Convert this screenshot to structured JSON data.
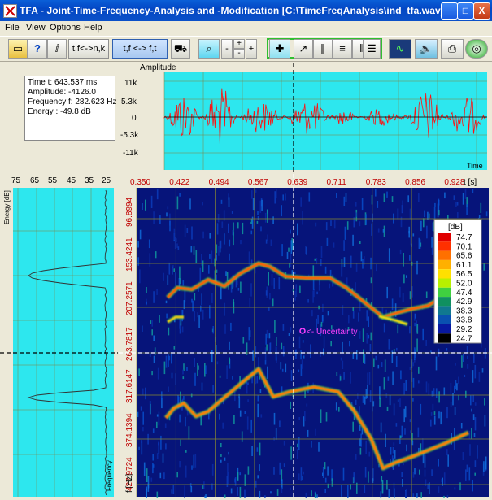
{
  "window": {
    "title": "TFA - Joint-Time-Frequency-Analysis and -Modification [C:\\TimeFreqAnalysis\\ind_tfa.wav]",
    "min_label": "_",
    "max_label": "□",
    "close_label": "X"
  },
  "menu": {
    "items": [
      {
        "label": "File"
      },
      {
        "label": "View"
      },
      {
        "label": "Options"
      },
      {
        "label": "Help"
      }
    ]
  },
  "toolbar": {
    "btn_tf_nk": "t,f<->n,k",
    "btn_tf_ft": "t,f <-> f,t",
    "minus_label": "-",
    "plus_label": "+",
    "plus_top_label": "+",
    "minus_bottom_label": "-"
  },
  "info": {
    "time": "Time t: 643.537 ms",
    "amplitude": "Amplitude: -4126.0",
    "frequency": "Frequency f: 282.623 Hz",
    "energy": "Energy : -49.8 dB"
  },
  "amplitude_plot": {
    "title": "Amplitude",
    "y_ticks": [
      "11k",
      "5.3k",
      "0",
      "-5.3k",
      "-11k"
    ],
    "x_label": "Time"
  },
  "energy_plot": {
    "x_ticks": [
      "75",
      "65",
      "55",
      "45",
      "35",
      "25"
    ],
    "y_label": "Energy [dB]",
    "bottom_label": "Frequency"
  },
  "spectrogram": {
    "time_ticks": [
      "0.350",
      "0.422",
      "0.494",
      "0.567",
      "0.639",
      "0.711",
      "0.783",
      "0.856",
      "0.928"
    ],
    "time_unit": "t [s]",
    "freq_ticks": [
      "96.8994",
      "153.4241",
      "207.2571",
      "263.7817",
      "317.6147",
      "374.1394",
      "427.9724"
    ],
    "freq_unit": "f [Hz]",
    "uncertainty_label": "<- Uncertainty",
    "legend": {
      "title": "[dB]",
      "values": [
        "74.7",
        "70.1",
        "65.6",
        "61.1",
        "56.5",
        "52.0",
        "47.4",
        "42.9",
        "38.3",
        "33.8",
        "29.2",
        "24.7"
      ],
      "colors": [
        "#e00000",
        "#ff3000",
        "#ff7000",
        "#ffb000",
        "#ffe000",
        "#b8f000",
        "#40d040",
        "#109060",
        "#107890",
        "#0a50b0",
        "#0818a0",
        "#000000"
      ]
    }
  }
}
